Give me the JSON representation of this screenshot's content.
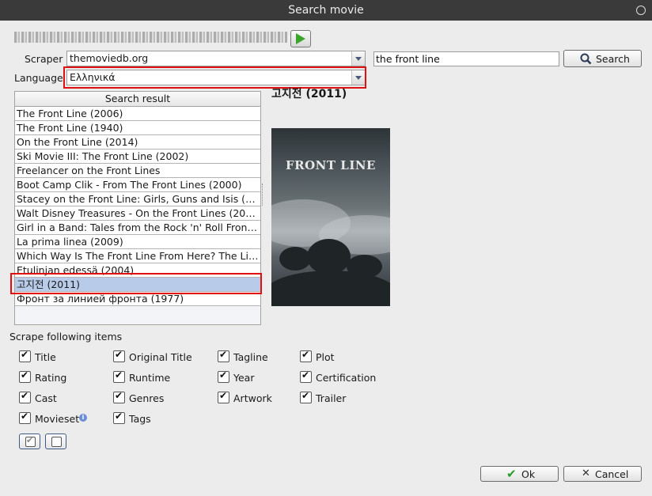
{
  "window": {
    "title": "Search movie"
  },
  "file": {
    "obscured_name": "░░░░░░░░"
  },
  "scraper": {
    "label": "Scraper",
    "value": "themoviedb.org"
  },
  "search": {
    "query": "the front line",
    "button_label": "Search"
  },
  "language": {
    "label": "Language",
    "value": "Ελληνικά"
  },
  "results": {
    "header": "Search result",
    "items": [
      "The Front Line (2006)",
      "The Front Line (1940)",
      "On the Front Line (2014)",
      "Ski Movie III: The Front Line (2002)",
      "Freelancer on the Front Lines",
      "Boot Camp Clik - From The Front Lines (2000)",
      "Stacey on the Front Line: Girls, Guns and Isis (2...",
      "Walt Disney Treasures - On the Front Lines (2004)",
      "Girl in a Band: Tales from the Rock 'n' Roll Front ...",
      "La prima linea (2009)",
      "Which Way Is The Front Line From Here? The Lif...",
      "Etulinjan edessä (2004)",
      "고지전 (2011)",
      "Фронт за линией фронта (1977)"
    ],
    "selected_index": 12
  },
  "detail": {
    "title": "고지전 (2011)",
    "poster_text": "FRONT LINE"
  },
  "scrape": {
    "label": "Scrape following items",
    "items": {
      "title": "Title",
      "original_title": "Original Title",
      "tagline": "Tagline",
      "plot": "Plot",
      "rating": "Rating",
      "runtime": "Runtime",
      "year": "Year",
      "certification": "Certification",
      "cast": "Cast",
      "genres": "Genres",
      "artwork": "Artwork",
      "trailer": "Trailer",
      "movieset": "Movieset",
      "tags": "Tags"
    }
  },
  "footer": {
    "ok_label": "Ok",
    "cancel_label": "Cancel"
  },
  "colors": {
    "selection": "#b8cbe8",
    "highlight_box": "#e01010",
    "titlebar": "#3a3a3a"
  },
  "icons": {
    "play": "play-icon",
    "search": "magnifier-icon",
    "ok": "checkmark-icon",
    "cancel": "x-icon",
    "info": "info-icon"
  }
}
